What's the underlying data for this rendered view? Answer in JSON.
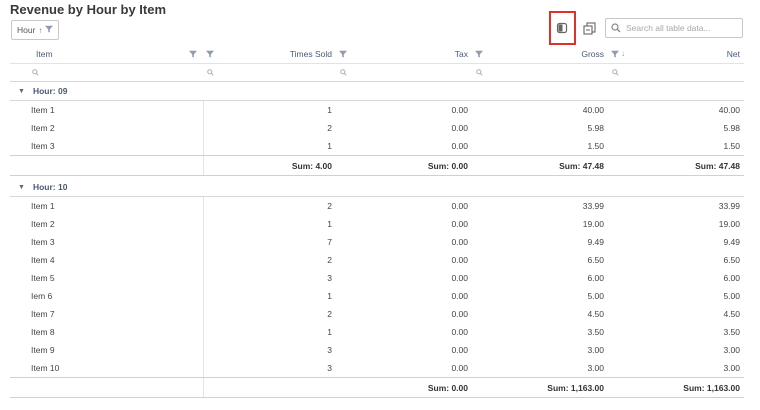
{
  "title": "Revenue by Hour by Item",
  "group_chip": {
    "label": "Hour",
    "sort_icon": "sort-asc-icon"
  },
  "toolbar": {
    "search_placeholder": "Search all table data..."
  },
  "columns": [
    {
      "label": "Item"
    },
    {
      "label": "Times Sold"
    },
    {
      "label": "Tax"
    },
    {
      "label": "Gross"
    },
    {
      "label": "Net",
      "sort": "desc"
    }
  ],
  "groups": [
    {
      "label": "Hour: 09",
      "rows": [
        {
          "item": "Item 1",
          "times_sold": "1",
          "tax": "0.00",
          "gross": "40.00",
          "net": "40.00"
        },
        {
          "item": "Item 2",
          "times_sold": "2",
          "tax": "0.00",
          "gross": "5.98",
          "net": "5.98"
        },
        {
          "item": "Item 3",
          "times_sold": "1",
          "tax": "0.00",
          "gross": "1.50",
          "net": "1.50"
        }
      ],
      "sums": {
        "times_sold": "Sum: 4.00",
        "tax": "Sum: 0.00",
        "gross": "Sum: 47.48",
        "net": "Sum: 47.48"
      }
    },
    {
      "label": "Hour: 10",
      "rows": [
        {
          "item": "Item 1",
          "times_sold": "2",
          "tax": "0.00",
          "gross": "33.99",
          "net": "33.99"
        },
        {
          "item": "Item 2",
          "times_sold": "1",
          "tax": "0.00",
          "gross": "19.00",
          "net": "19.00"
        },
        {
          "item": "Item 3",
          "times_sold": "7",
          "tax": "0.00",
          "gross": "9.49",
          "net": "9.49"
        },
        {
          "item": "Item 4",
          "times_sold": "2",
          "tax": "0.00",
          "gross": "6.50",
          "net": "6.50"
        },
        {
          "item": "Item 5",
          "times_sold": "3",
          "tax": "0.00",
          "gross": "6.00",
          "net": "6.00"
        },
        {
          "item": "Iem 6",
          "times_sold": "1",
          "tax": "0.00",
          "gross": "5.00",
          "net": "5.00"
        },
        {
          "item": "Item 7",
          "times_sold": "2",
          "tax": "0.00",
          "gross": "4.50",
          "net": "4.50"
        },
        {
          "item": "Item 8",
          "times_sold": "1",
          "tax": "0.00",
          "gross": "3.50",
          "net": "3.50"
        },
        {
          "item": "Item 9",
          "times_sold": "3",
          "tax": "0.00",
          "gross": "3.00",
          "net": "3.00"
        },
        {
          "item": "Item 10",
          "times_sold": "3",
          "tax": "0.00",
          "gross": "3.00",
          "net": "3.00"
        }
      ],
      "sums": {
        "times_sold": "",
        "tax": "Sum: 0.00",
        "gross": "Sum: 1,163.00",
        "net": "Sum: 1,163.00"
      }
    }
  ],
  "colors": {
    "accent": "#4a5a78",
    "highlight": "#e0302a",
    "border": "#d7d7d7"
  }
}
